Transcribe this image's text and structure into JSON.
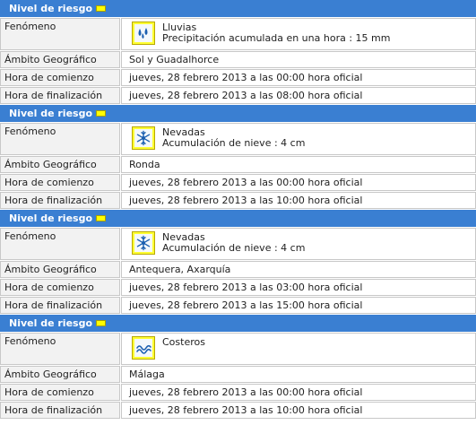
{
  "risk_header_label": "Nivel de riesgo",
  "warnings": [
    {
      "phenomenon_label": "Fenómeno",
      "phenomenon": "Lluvias",
      "phenomenon_detail": "Precipitación acumulada en una hora : 15 mm",
      "icon": "rain-icon",
      "area_label": "Ámbito Geográfico",
      "area": "Sol y Guadalhorce",
      "start_label": "Hora de comienzo",
      "start": "jueves, 28 febrero 2013 a las 00:00 hora oficial",
      "end_label": "Hora de finalización",
      "end": "jueves, 28 febrero 2013 a las 08:00 hora oficial"
    },
    {
      "phenomenon_label": "Fenómeno",
      "phenomenon": "Nevadas",
      "phenomenon_detail": "Acumulación de nieve : 4 cm",
      "icon": "snowflake-icon",
      "area_label": "Ámbito Geográfico",
      "area": "Ronda",
      "start_label": "Hora de comienzo",
      "start": "jueves, 28 febrero 2013 a las 00:00 hora oficial",
      "end_label": "Hora de finalización",
      "end": "jueves, 28 febrero 2013 a las 10:00 hora oficial"
    },
    {
      "phenomenon_label": "Fenómeno",
      "phenomenon": "Nevadas",
      "phenomenon_detail": "Acumulación de nieve : 4 cm",
      "icon": "snowflake-icon",
      "area_label": "Ámbito Geográfico",
      "area": "Antequera, Axarquía",
      "start_label": "Hora de comienzo",
      "start": "jueves, 28 febrero 2013 a las 03:00 hora oficial",
      "end_label": "Hora de finalización",
      "end": "jueves, 28 febrero 2013 a las 15:00 hora oficial"
    },
    {
      "phenomenon_label": "Fenómeno",
      "phenomenon": "Costeros",
      "phenomenon_detail": "",
      "icon": "coastal-waves-icon",
      "area_label": "Ámbito Geográfico",
      "area": "Málaga",
      "start_label": "Hora de comienzo",
      "start": "jueves, 28 febrero 2013 a las 00:00 hora oficial",
      "end_label": "Hora de finalización",
      "end": "jueves, 28 febrero 2013 a las 10:00 hora oficial"
    }
  ],
  "colors": {
    "header_bg": "#3a7fd2",
    "risk_level_yellow": "#ffff00",
    "label_bg": "#f2f2f2"
  }
}
